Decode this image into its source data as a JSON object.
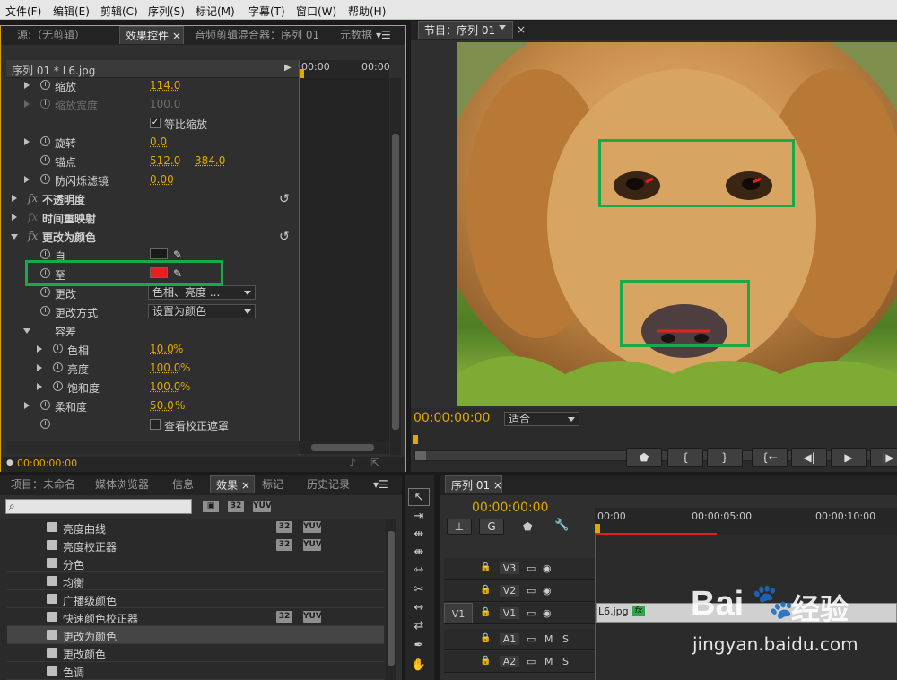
{
  "menu": [
    "文件(F)",
    "编辑(E)",
    "剪辑(C)",
    "序列(S)",
    "标记(M)",
    "字幕(T)",
    "窗口(W)",
    "帮助(H)"
  ],
  "effect_controls": {
    "tabs": [
      "源:（无剪辑）",
      "效果控件",
      "音频剪辑混合器：序列 01",
      "元数据"
    ],
    "tab_close": "×",
    "header": "序列 01 * L6.jpg",
    "ruler": [
      "00:00",
      "00:00"
    ],
    "rows": {
      "scale": {
        "label": "缩放",
        "value": "114.0"
      },
      "scale_width": {
        "label": "缩放宽度",
        "value": "100.0"
      },
      "uniform": {
        "label": "等比缩放",
        "check": "✓"
      },
      "rotation": {
        "label": "旋转",
        "value": "0.0"
      },
      "anchor": {
        "label": "锚点",
        "x": "512.0",
        "y": "384.0"
      },
      "flicker": {
        "label": "防闪烁滤镜",
        "value": "0.00"
      },
      "opacity": {
        "fx": "fx",
        "label": "不透明度"
      },
      "time_remap": {
        "fx": "fx",
        "label": "时间重映射"
      },
      "change_to_color": {
        "fx": "fx",
        "label": "更改为颜色"
      },
      "from": {
        "label": "自"
      },
      "to": {
        "label": "至"
      },
      "change": {
        "label": "更改",
        "value": "色相、亮度 ..."
      },
      "change_by": {
        "label": "更改方式",
        "value": "设置为颜色"
      },
      "tolerance": {
        "label": "容差"
      },
      "hue": {
        "label": "色相",
        "value": "10.0",
        "unit": "%"
      },
      "lightness": {
        "label": "亮度",
        "value": "100.0",
        "unit": "%"
      },
      "saturation": {
        "label": "饱和度",
        "value": "100.0",
        "unit": "%"
      },
      "softness": {
        "label": "柔和度",
        "value": "50.0",
        "unit": "%"
      },
      "view_matte": {
        "label": "查看校正遮罩"
      }
    },
    "timecode": "00:00:00:00",
    "reset_glyph": "↺",
    "menu_glyph": "▾☰"
  },
  "program": {
    "tab": "节目：序列 01",
    "timecode": "00:00:00:00",
    "fit": "适合",
    "buttons": [
      "⬟",
      "{",
      "}",
      "{←",
      "◀|",
      "▶",
      "|▶"
    ]
  },
  "project": {
    "tabs": [
      "项目：未命名",
      "媒体浏览器",
      "信息",
      "效果",
      "标记",
      "历史记录"
    ],
    "badges": [
      "32",
      "YUV"
    ],
    "search_placeholder": "",
    "effects": [
      "亮度曲线",
      "亮度校正器",
      "分色",
      "均衡",
      "广播级颜色",
      "快速颜色校正器",
      "更改为颜色",
      "更改颜色",
      "色调"
    ],
    "effect_badges": [
      [
        true,
        true
      ],
      [
        true,
        true
      ],
      [
        false,
        false
      ],
      [
        false,
        false
      ],
      [
        false,
        false
      ],
      [
        true,
        true
      ],
      [
        false,
        false
      ],
      [
        false,
        false
      ],
      [
        false,
        false
      ]
    ]
  },
  "timeline": {
    "tab": "序列 01",
    "timecode": "00:00:00:00",
    "ruler": [
      "00:00",
      "00:00:05:00",
      "00:00:10:00"
    ],
    "tracks": [
      {
        "name": "V3",
        "kind": "v"
      },
      {
        "name": "V2",
        "kind": "v"
      },
      {
        "name": "V1",
        "kind": "v",
        "source": "V1"
      },
      {
        "name": "A1",
        "kind": "a"
      },
      {
        "name": "A2",
        "kind": "a"
      }
    ],
    "clip": {
      "name": "L6.jpg",
      "fx": "fx"
    },
    "mute": "M",
    "solo": "S"
  },
  "watermark": {
    "brand": "Bai",
    "brand2": "经验",
    "url": "jingyan.baidu.com"
  },
  "colors": {
    "accent": "#e0a800",
    "highlight": "#19a84a",
    "playhead": "#e02020",
    "to_swatch": "#e8201c",
    "from_swatch": "#1a1a1a"
  }
}
